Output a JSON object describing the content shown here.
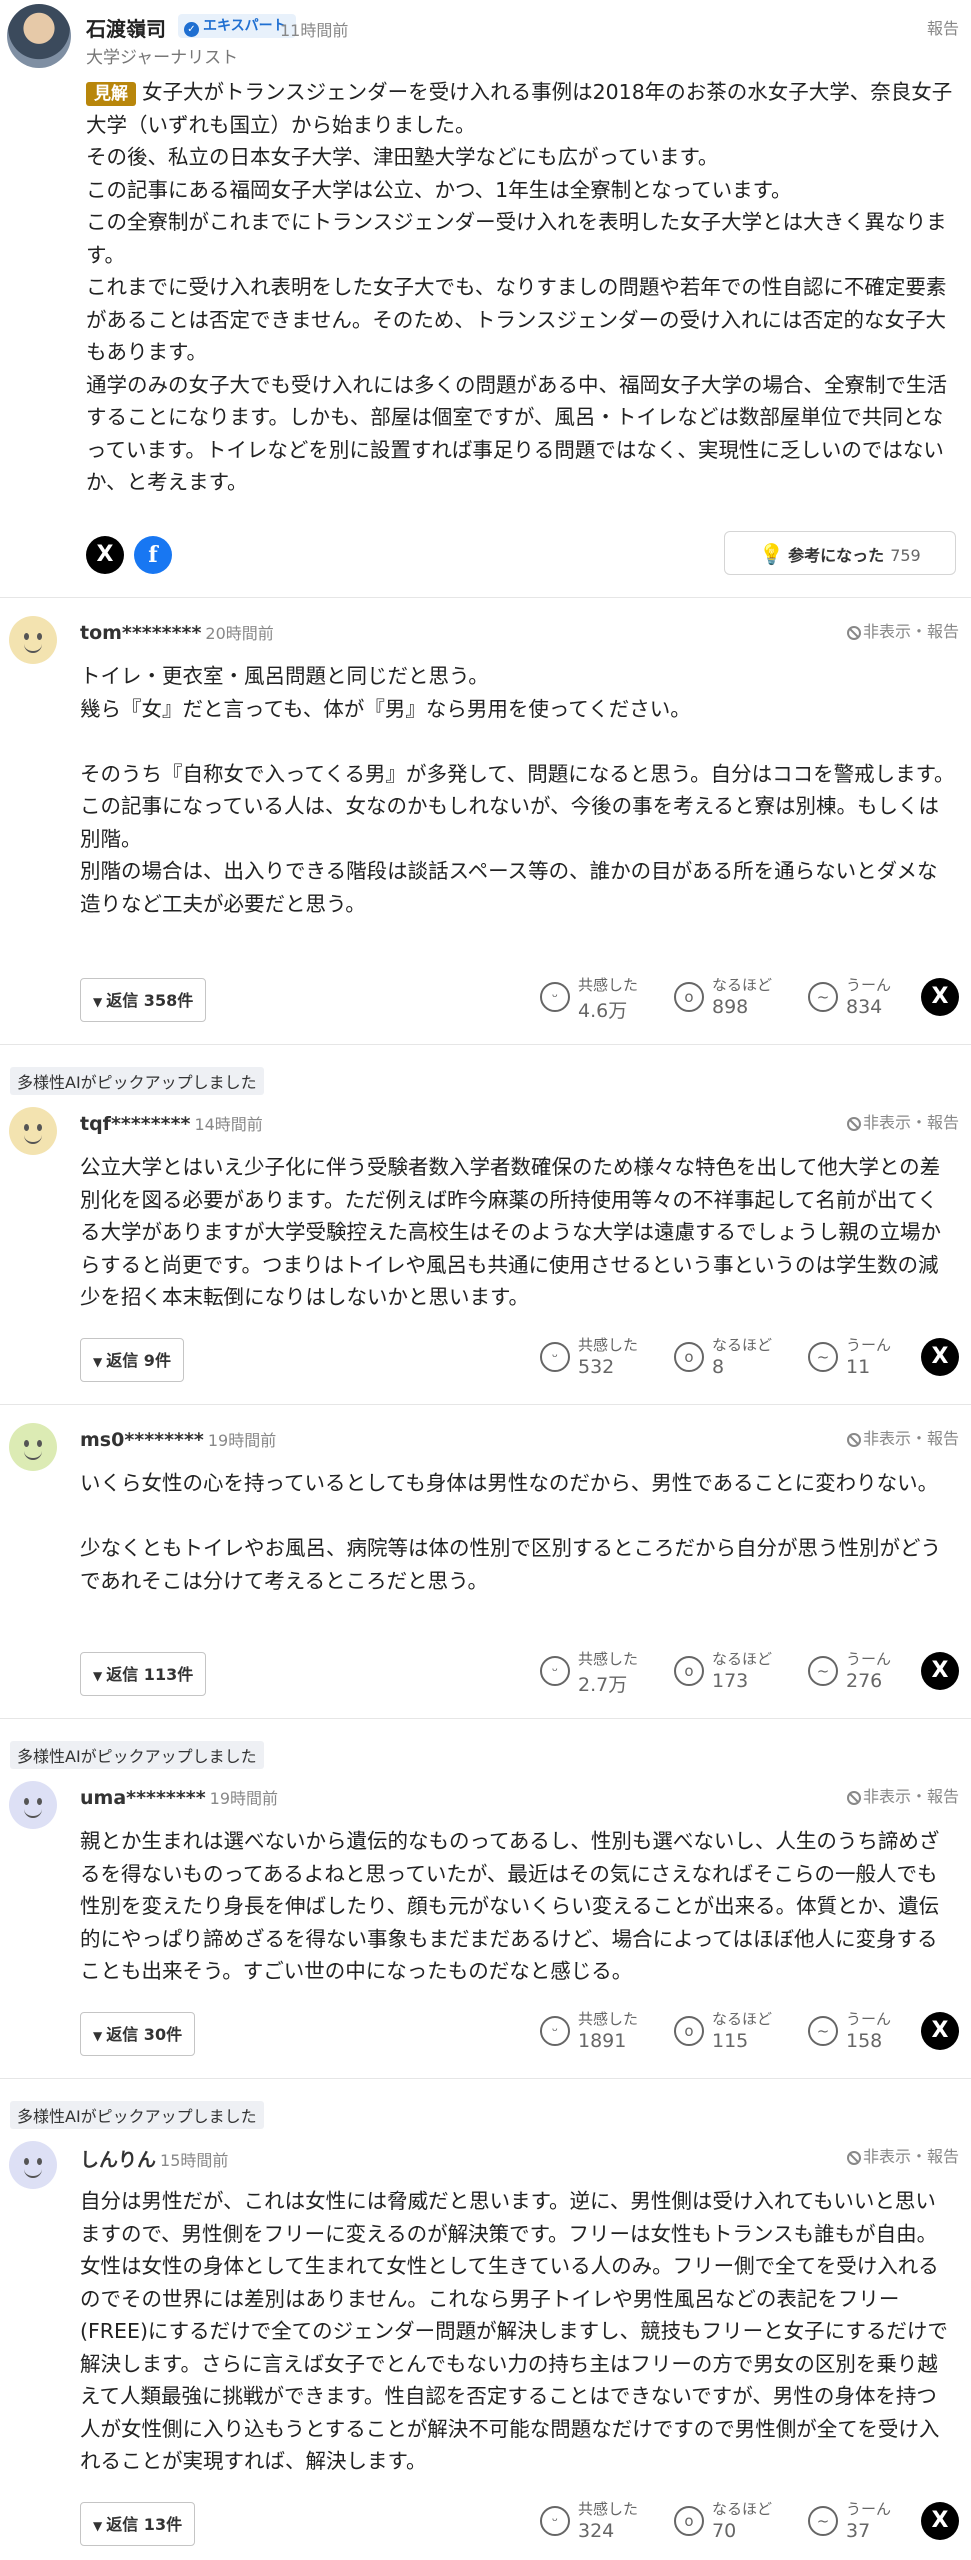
{
  "expert": {
    "name": "石渡嶺司",
    "badge": "エキスパート",
    "time": "11時間前",
    "title": "大学ジャーナリスト",
    "report": "報告",
    "tag": "見解",
    "paragraphs": [
      "女子大がトランスジェンダーを受け入れる事例は2018年のお茶の水女子大学、奈良女子大学（いずれも国立）から始まりました。",
      "その後、私立の日本女子大学、津田塾大学などにも広がっています。",
      "この記事にある福岡女子大学は公立、かつ、1年生は全寮制となっています。",
      "この全寮制がこれまでにトランスジェンダー受け入れを表明した女子大学とは大きく異なります。",
      "これまでに受け入れ表明をした女子大でも、なりすましの問題や若年での性自認に不確定要素があることは否定できません。そのため、トランスジェンダーの受け入れには否定的な女子大もあります。",
      "通学のみの女子大でも受け入れには多くの問題がある中、福岡女子大学の場合、全寮制で生活することになります。しかも、部屋は個室ですが、風呂・トイレなどは数部屋単位で共同となっています。トイレなどを別に設置すれば事足りる問題ではなく、実現性に乏しいのではないか、と考えます。"
    ],
    "helpful_label": "参考になった",
    "helpful_count": "759",
    "share_x_icon": "X",
    "share_fb_icon": "f"
  },
  "labels": {
    "ai_pick": "多様性AIがピックアップしました",
    "hide_report": "非表示・報告",
    "react_1": "共感した",
    "react_2": "なるほど",
    "react_3": "うーん",
    "x_icon": "X"
  },
  "comments": [
    {
      "user": "tom********",
      "time": "20時間前",
      "avatar_color": "#f3e3b0",
      "paragraphs": [
        "トイレ・更衣室・風呂問題と同じだと思う。",
        "幾ら『女』だと言っても、体が『男』なら男用を使ってください。",
        "",
        "そのうち『自称女で入ってくる男』が多発して、問題になると思う。自分はココを警戒します。",
        "この記事になっている人は、女なのかもしれないが、今後の事を考えると寮は別棟。もしくは別階。",
        "別階の場合は、出入りできる階段は談話スペース等の、誰かの目がある所を通らないとダメな造りなど工夫が必要だと思う。"
      ],
      "reply": "返信 358件",
      "empathy": "4.6万",
      "naruhodo": "898",
      "uun": "834"
    },
    {
      "user": "tqf********",
      "time": "14時間前",
      "avatar_color": "#f3e3b0",
      "paragraphs": [
        "公立大学とはいえ少子化に伴う受験者数入学者数確保のため様々な特色を出して他大学との差別化を図る必要があります。ただ例えば昨今麻薬の所持使用等々の不祥事起して名前が出てくる大学がありますが大学受験控えた高校生はそのような大学は遠慮するでしょうし親の立場からすると尚更です。つまりはトイレや風呂も共通に使用させるという事というのは学生数の減少を招く本末転倒になりはしないかと思います。"
      ],
      "reply": "返信 9件",
      "empathy": "532",
      "naruhodo": "8",
      "uun": "11"
    },
    {
      "user": "ms0********",
      "time": "19時間前",
      "avatar_color": "#dcebb4",
      "paragraphs": [
        "いくら女性の心を持っているとしても身体は男性なのだから、男性であることに変わりない。",
        "",
        "少なくともトイレやお風呂、病院等は体の性別で区別するところだから自分が思う性別がどうであれそこは分けて考えるところだと思う。"
      ],
      "reply": "返信 113件",
      "empathy": "2.7万",
      "naruhodo": "173",
      "uun": "276"
    },
    {
      "user": "uma********",
      "time": "19時間前",
      "avatar_color": "#dde0f5",
      "paragraphs": [
        "親とか生まれは選べないから遺伝的なものってあるし、性別も選べないし、人生のうち諦めざるを得ないものってあるよねと思っていたが、最近はその気にさえなればそこらの一般人でも性別を変えたり身長を伸ばしたり、顔も元がないくらい変えることが出来る。体質とか、遺伝的にやっぱり諦めざるを得ない事象もまだまだあるけど、場合によってはほぼ他人に変身することも出来そう。すごい世の中になったものだなと感じる。"
      ],
      "reply": "返信 30件",
      "empathy": "1891",
      "naruhodo": "115",
      "uun": "158"
    },
    {
      "user": "しんりん",
      "time": "15時間前",
      "avatar_color": "#dde0f5",
      "paragraphs": [
        "自分は男性だが、これは女性には脅威だと思います。逆に、男性側は受け入れてもいいと思いますので、男性側をフリーに変えるのが解決策です。フリーは女性もトランスも誰もが自由。女性は女性の身体として生まれて女性として生きている人のみ。フリー側で全てを受け入れるのでその世界には差別はありません。これなら男子トイレや男性風呂などの表記をフリー(FREE)にするだけで全てのジェンダー問題が解決しますし、競技もフリーと女子にするだけで解決します。さらに言えば女子でとんでもない力の持ち主はフリーの方で男女の区別を乗り越えて人類最強に挑戦ができます。性自認を否定することはできないですが、男性の身体を持つ人が女性側に入り込もうとすることが解決不可能な問題なだけですので男性側が全てを受け入れることが実現すれば、解決します。"
      ],
      "reply": "返信 13件",
      "empathy": "324",
      "naruhodo": "70",
      "uun": "37"
    }
  ]
}
